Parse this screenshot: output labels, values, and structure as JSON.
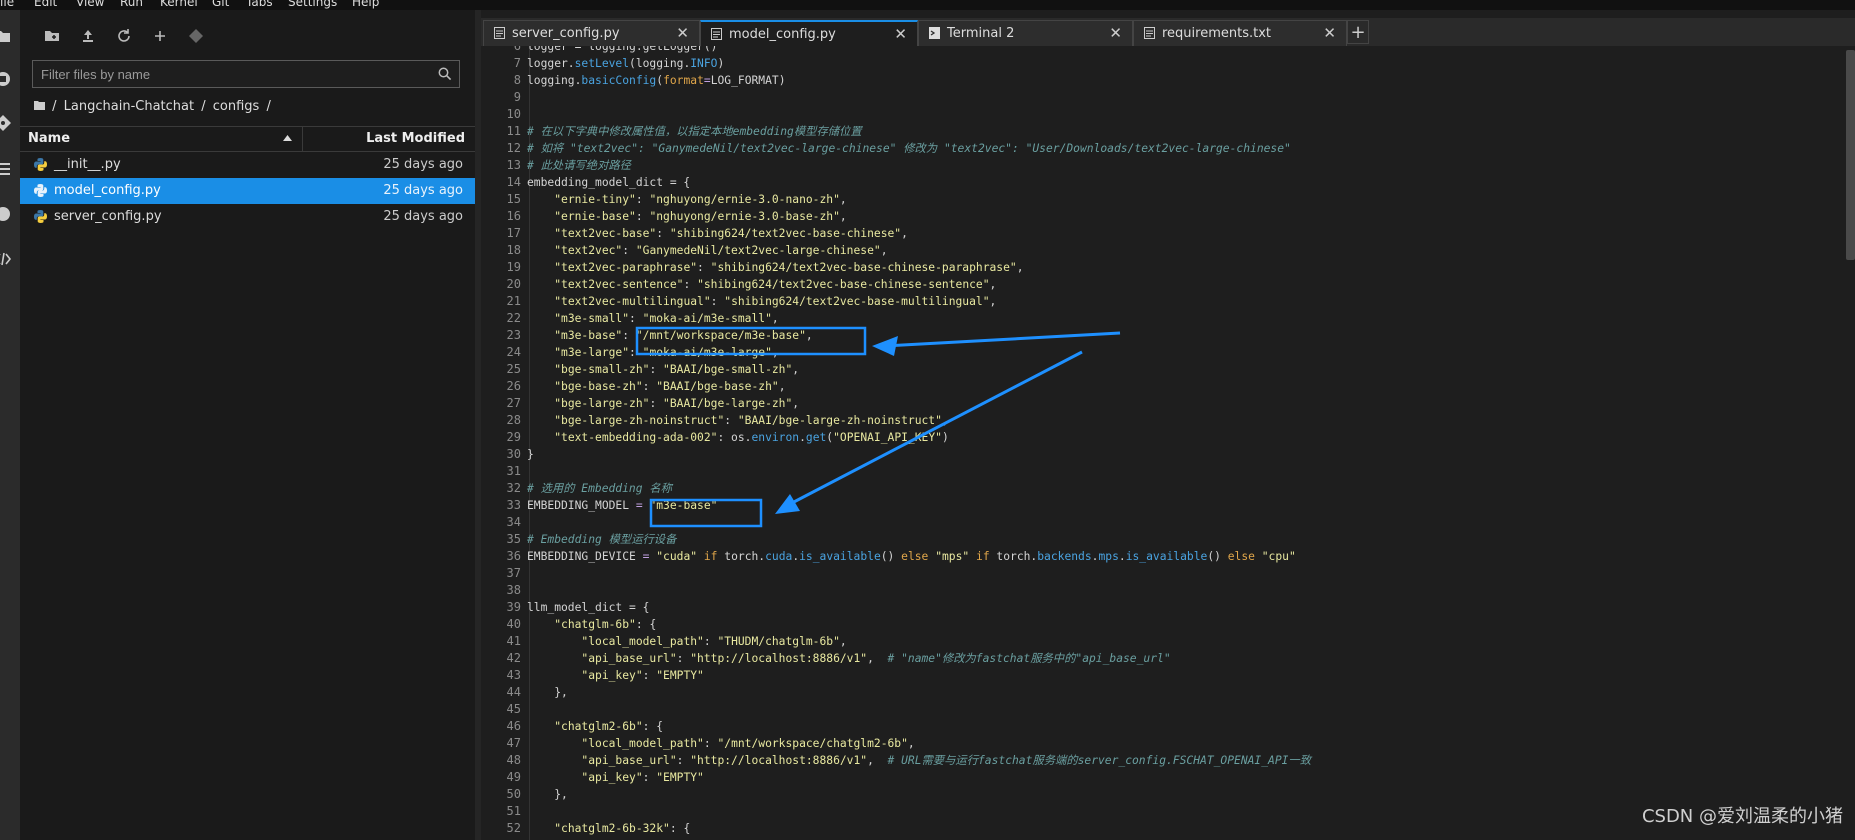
{
  "menu": [
    "File",
    "Edit",
    "View",
    "Run",
    "Kernel",
    "Git",
    "Tabs",
    "Settings",
    "Help"
  ],
  "filebrowser": {
    "filter_placeholder": "Filter files by name",
    "breadcrumb": [
      "/",
      "Langchain-Chatchat",
      "/",
      "configs",
      "/"
    ],
    "col_name": "Name",
    "col_modified": "Last Modified",
    "files": [
      {
        "name": "__init__.py",
        "modified": "25 days ago",
        "selected": false
      },
      {
        "name": "model_config.py",
        "modified": "25 days ago",
        "selected": true
      },
      {
        "name": "server_config.py",
        "modified": "25 days ago",
        "selected": false
      }
    ]
  },
  "tabs": [
    {
      "label": "server_config.py",
      "icon": "file-icon",
      "active": false
    },
    {
      "label": "model_config.py",
      "icon": "file-icon",
      "active": true
    },
    {
      "label": "Terminal 2",
      "icon": "terminal-icon",
      "active": false
    },
    {
      "label": "requirements.txt",
      "icon": "file-icon",
      "active": false
    }
  ],
  "add_tab_label": "+",
  "code": [
    {
      "n": "6",
      "t": [
        [
          "c-def",
          "logger = logging.getLogger()"
        ]
      ]
    },
    {
      "n": "7",
      "t": [
        [
          "c-def",
          "logger."
        ],
        [
          "c-fn",
          "setLevel"
        ],
        [
          "c-def",
          "(logging."
        ],
        [
          "c-fn",
          "INFO"
        ],
        [
          "c-def",
          ")"
        ]
      ]
    },
    {
      "n": "8",
      "t": [
        [
          "c-def",
          "logging."
        ],
        [
          "c-fn",
          "basicConfig"
        ],
        [
          "c-def",
          "("
        ],
        [
          "c-kw",
          "format"
        ],
        [
          "c-op",
          "="
        ],
        [
          "c-def",
          "LOG_FORMAT)"
        ]
      ]
    },
    {
      "n": "9",
      "t": []
    },
    {
      "n": "10",
      "t": []
    },
    {
      "n": "11",
      "t": [
        [
          "c-cm",
          "# 在以下字典中修改属性值，以指定本地embedding模型存储位置"
        ]
      ]
    },
    {
      "n": "12",
      "t": [
        [
          "c-cm",
          "# 如将 \"text2vec\": \"GanymedeNil/text2vec-large-chinese\" 修改为 \"text2vec\": \"User/Downloads/text2vec-large-chinese\""
        ]
      ]
    },
    {
      "n": "13",
      "t": [
        [
          "c-cm",
          "# 此处请写绝对路径"
        ]
      ]
    },
    {
      "n": "14",
      "t": [
        [
          "c-def",
          "embedding_model_dict = {"
        ]
      ]
    },
    {
      "n": "15",
      "t": [
        [
          "c-def",
          "    "
        ],
        [
          "c-str",
          "\"ernie-tiny\""
        ],
        [
          "c-def",
          ": "
        ],
        [
          "c-str",
          "\"nghuyong/ernie-3.0-nano-zh\""
        ],
        [
          "c-def",
          ","
        ]
      ]
    },
    {
      "n": "16",
      "t": [
        [
          "c-def",
          "    "
        ],
        [
          "c-str",
          "\"ernie-base\""
        ],
        [
          "c-def",
          ": "
        ],
        [
          "c-str",
          "\"nghuyong/ernie-3.0-base-zh\""
        ],
        [
          "c-def",
          ","
        ]
      ]
    },
    {
      "n": "17",
      "t": [
        [
          "c-def",
          "    "
        ],
        [
          "c-str",
          "\"text2vec-base\""
        ],
        [
          "c-def",
          ": "
        ],
        [
          "c-str",
          "\"shibing624/text2vec-base-chinese\""
        ],
        [
          "c-def",
          ","
        ]
      ]
    },
    {
      "n": "18",
      "t": [
        [
          "c-def",
          "    "
        ],
        [
          "c-str",
          "\"text2vec\""
        ],
        [
          "c-def",
          ": "
        ],
        [
          "c-str",
          "\"GanymedeNil/text2vec-large-chinese\""
        ],
        [
          "c-def",
          ","
        ]
      ]
    },
    {
      "n": "19",
      "t": [
        [
          "c-def",
          "    "
        ],
        [
          "c-str",
          "\"text2vec-paraphrase\""
        ],
        [
          "c-def",
          ": "
        ],
        [
          "c-str",
          "\"shibing624/text2vec-base-chinese-paraphrase\""
        ],
        [
          "c-def",
          ","
        ]
      ]
    },
    {
      "n": "20",
      "t": [
        [
          "c-def",
          "    "
        ],
        [
          "c-str",
          "\"text2vec-sentence\""
        ],
        [
          "c-def",
          ": "
        ],
        [
          "c-str",
          "\"shibing624/text2vec-base-chinese-sentence\""
        ],
        [
          "c-def",
          ","
        ]
      ]
    },
    {
      "n": "21",
      "t": [
        [
          "c-def",
          "    "
        ],
        [
          "c-str",
          "\"text2vec-multilingual\""
        ],
        [
          "c-def",
          ": "
        ],
        [
          "c-str",
          "\"shibing624/text2vec-base-multilingual\""
        ],
        [
          "c-def",
          ","
        ]
      ]
    },
    {
      "n": "22",
      "t": [
        [
          "c-def",
          "    "
        ],
        [
          "c-str",
          "\"m3e-small\""
        ],
        [
          "c-def",
          ": "
        ],
        [
          "c-str",
          "\"moka-ai/m3e-small\""
        ],
        [
          "c-def",
          ","
        ]
      ]
    },
    {
      "n": "23",
      "t": [
        [
          "c-def",
          "    "
        ],
        [
          "c-str",
          "\"m3e-base\""
        ],
        [
          "c-def",
          ": "
        ],
        [
          "c-str",
          "\"/mnt/workspace/m3e-base\""
        ],
        [
          "c-def",
          ","
        ]
      ]
    },
    {
      "n": "24",
      "t": [
        [
          "c-def",
          "    "
        ],
        [
          "c-str",
          "\"m3e-large\""
        ],
        [
          "c-def",
          ": "
        ],
        [
          "c-str",
          "\"moka-ai/m3e-large\""
        ],
        [
          "c-def",
          ","
        ]
      ]
    },
    {
      "n": "25",
      "t": [
        [
          "c-def",
          "    "
        ],
        [
          "c-str",
          "\"bge-small-zh\""
        ],
        [
          "c-def",
          ": "
        ],
        [
          "c-str",
          "\"BAAI/bge-small-zh\""
        ],
        [
          "c-def",
          ","
        ]
      ]
    },
    {
      "n": "26",
      "t": [
        [
          "c-def",
          "    "
        ],
        [
          "c-str",
          "\"bge-base-zh\""
        ],
        [
          "c-def",
          ": "
        ],
        [
          "c-str",
          "\"BAAI/bge-base-zh\""
        ],
        [
          "c-def",
          ","
        ]
      ]
    },
    {
      "n": "27",
      "t": [
        [
          "c-def",
          "    "
        ],
        [
          "c-str",
          "\"bge-large-zh\""
        ],
        [
          "c-def",
          ": "
        ],
        [
          "c-str",
          "\"BAAI/bge-large-zh\""
        ],
        [
          "c-def",
          ","
        ]
      ]
    },
    {
      "n": "28",
      "t": [
        [
          "c-def",
          "    "
        ],
        [
          "c-str",
          "\"bge-large-zh-noinstruct\""
        ],
        [
          "c-def",
          ": "
        ],
        [
          "c-str",
          "\"BAAI/bge-large-zh-noinstruct\""
        ],
        [
          "c-def",
          ","
        ]
      ]
    },
    {
      "n": "29",
      "t": [
        [
          "c-def",
          "    "
        ],
        [
          "c-str",
          "\"text-embedding-ada-002\""
        ],
        [
          "c-def",
          ": os."
        ],
        [
          "c-fn",
          "environ"
        ],
        [
          "c-def",
          "."
        ],
        [
          "c-fn",
          "get"
        ],
        [
          "c-def",
          "("
        ],
        [
          "c-str",
          "\"OPENAI_API_KEY\""
        ],
        [
          "c-def",
          ")"
        ]
      ]
    },
    {
      "n": "30",
      "t": [
        [
          "c-def",
          "}"
        ]
      ]
    },
    {
      "n": "31",
      "t": []
    },
    {
      "n": "32",
      "t": [
        [
          "c-cm",
          "# 选用的 Embedding 名称"
        ]
      ]
    },
    {
      "n": "33",
      "t": [
        [
          "c-def",
          "EMBEDDING_MODEL "
        ],
        [
          "c-op",
          "="
        ],
        [
          "c-def",
          " "
        ],
        [
          "c-str",
          "\"m3e-base\""
        ]
      ]
    },
    {
      "n": "34",
      "t": []
    },
    {
      "n": "35",
      "t": [
        [
          "c-cm",
          "# Embedding 模型运行设备"
        ]
      ]
    },
    {
      "n": "36",
      "t": [
        [
          "c-def",
          "EMBEDDING_DEVICE "
        ],
        [
          "c-op",
          "="
        ],
        [
          "c-def",
          " "
        ],
        [
          "c-str",
          "\"cuda\""
        ],
        [
          "c-def",
          " "
        ],
        [
          "c-kw",
          "if"
        ],
        [
          "c-def",
          " torch."
        ],
        [
          "c-fn",
          "cuda"
        ],
        [
          "c-def",
          "."
        ],
        [
          "c-fn",
          "is_available"
        ],
        [
          "c-def",
          "() "
        ],
        [
          "c-kw",
          "else"
        ],
        [
          "c-def",
          " "
        ],
        [
          "c-str",
          "\"mps\""
        ],
        [
          "c-def",
          " "
        ],
        [
          "c-kw",
          "if"
        ],
        [
          "c-def",
          " torch."
        ],
        [
          "c-fn",
          "backends"
        ],
        [
          "c-def",
          "."
        ],
        [
          "c-fn",
          "mps"
        ],
        [
          "c-def",
          "."
        ],
        [
          "c-fn",
          "is_available"
        ],
        [
          "c-def",
          "() "
        ],
        [
          "c-kw",
          "else"
        ],
        [
          "c-def",
          " "
        ],
        [
          "c-str",
          "\"cpu\""
        ]
      ]
    },
    {
      "n": "37",
      "t": []
    },
    {
      "n": "38",
      "t": []
    },
    {
      "n": "39",
      "t": [
        [
          "c-def",
          "llm_model_dict = {"
        ]
      ]
    },
    {
      "n": "40",
      "t": [
        [
          "c-def",
          "    "
        ],
        [
          "c-str",
          "\"chatglm-6b\""
        ],
        [
          "c-def",
          ": {"
        ]
      ]
    },
    {
      "n": "41",
      "t": [
        [
          "c-def",
          "        "
        ],
        [
          "c-str",
          "\"local_model_path\""
        ],
        [
          "c-def",
          ": "
        ],
        [
          "c-str",
          "\"THUDM/chatglm-6b\""
        ],
        [
          "c-def",
          ","
        ]
      ]
    },
    {
      "n": "42",
      "t": [
        [
          "c-def",
          "        "
        ],
        [
          "c-str",
          "\"api_base_url\""
        ],
        [
          "c-def",
          ": "
        ],
        [
          "c-str",
          "\"http://localhost:8886/v1\""
        ],
        [
          "c-def",
          ",  "
        ],
        [
          "c-cm",
          "# \"name\"修改为fastchat服务中的\"api_base_url\""
        ]
      ]
    },
    {
      "n": "43",
      "t": [
        [
          "c-def",
          "        "
        ],
        [
          "c-str",
          "\"api_key\""
        ],
        [
          "c-def",
          ": "
        ],
        [
          "c-str",
          "\"EMPTY\""
        ]
      ]
    },
    {
      "n": "44",
      "t": [
        [
          "c-def",
          "    },"
        ]
      ]
    },
    {
      "n": "45",
      "t": []
    },
    {
      "n": "46",
      "t": [
        [
          "c-def",
          "    "
        ],
        [
          "c-str",
          "\"chatglm2-6b\""
        ],
        [
          "c-def",
          ": {"
        ]
      ]
    },
    {
      "n": "47",
      "t": [
        [
          "c-def",
          "        "
        ],
        [
          "c-str",
          "\"local_model_path\""
        ],
        [
          "c-def",
          ": "
        ],
        [
          "c-str",
          "\"/mnt/workspace/chatglm2-6b\""
        ],
        [
          "c-def",
          ","
        ]
      ]
    },
    {
      "n": "48",
      "t": [
        [
          "c-def",
          "        "
        ],
        [
          "c-str",
          "\"api_base_url\""
        ],
        [
          "c-def",
          ": "
        ],
        [
          "c-str",
          "\"http://localhost:8886/v1\""
        ],
        [
          "c-def",
          ",  "
        ],
        [
          "c-cm",
          "# URL需要与运行fastchat服务端的server_config.FSCHAT_OPENAI_API一致"
        ]
      ]
    },
    {
      "n": "49",
      "t": [
        [
          "c-def",
          "        "
        ],
        [
          "c-str",
          "\"api_key\""
        ],
        [
          "c-def",
          ": "
        ],
        [
          "c-str",
          "\"EMPTY\""
        ]
      ]
    },
    {
      "n": "50",
      "t": [
        [
          "c-def",
          "    },"
        ]
      ]
    },
    {
      "n": "51",
      "t": []
    },
    {
      "n": "52",
      "t": [
        [
          "c-def",
          "    "
        ],
        [
          "c-str",
          "\"chatglm2-6b-32k\""
        ],
        [
          "c-def",
          ": {"
        ]
      ]
    }
  ],
  "watermark": "CSDN @爱刘温柔的小猪",
  "colors": {
    "accent": "#1a8ee6",
    "annotation": "#1e90ff"
  }
}
